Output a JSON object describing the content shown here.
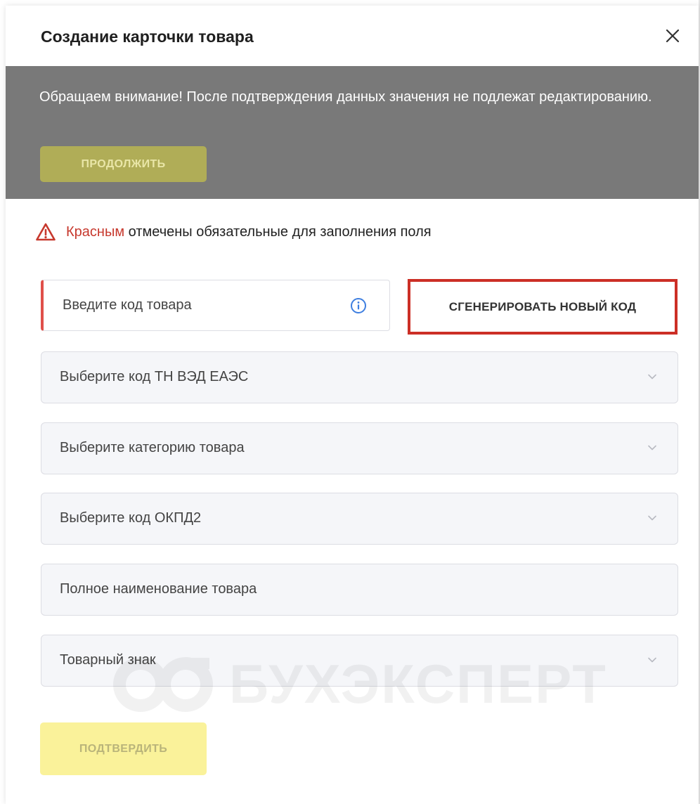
{
  "modal": {
    "title": "Создание карточки товара",
    "close_icon": "close-icon"
  },
  "notice": {
    "text": "Обращаем внимание! После подтверждения данных значения не подлежат редактированию.",
    "continue_label": "ПРОДОЛЖИТЬ",
    "background": "#797979"
  },
  "warning": {
    "icon": "warning-triangle-icon",
    "highlight": "Красным",
    "text": " отмечены обязательные для заполнения поля",
    "highlight_color": "#c7392e"
  },
  "form": {
    "code_field": {
      "placeholder": "Введите код товара",
      "info_icon": "info-icon",
      "required": true
    },
    "generate_label": "СГЕНЕРИРОВАТЬ НОВЫЙ КОД",
    "fields": [
      {
        "placeholder": "Выберите код ТН ВЭД ЕАЭС",
        "type": "select",
        "icon": "chevron-down-icon"
      },
      {
        "placeholder": "Выберите категорию товара",
        "type": "select",
        "icon": "chevron-down-icon"
      },
      {
        "placeholder": "Выберите код ОКПД2",
        "type": "select",
        "icon": "chevron-down-icon"
      },
      {
        "placeholder": "Полное наименование товара",
        "type": "text"
      },
      {
        "placeholder": "Товарный знак",
        "type": "select",
        "icon": "chevron-down-icon"
      }
    ],
    "confirm_label": "ПОДТВЕРДИТЬ"
  },
  "watermark": {
    "text": "БУХЭКСПЕРТ"
  },
  "colors": {
    "accent_red": "#cc2f26",
    "continue_button": "#b0ad57",
    "confirm_button": "#faf29a",
    "info_blue": "#3f7fe0"
  }
}
